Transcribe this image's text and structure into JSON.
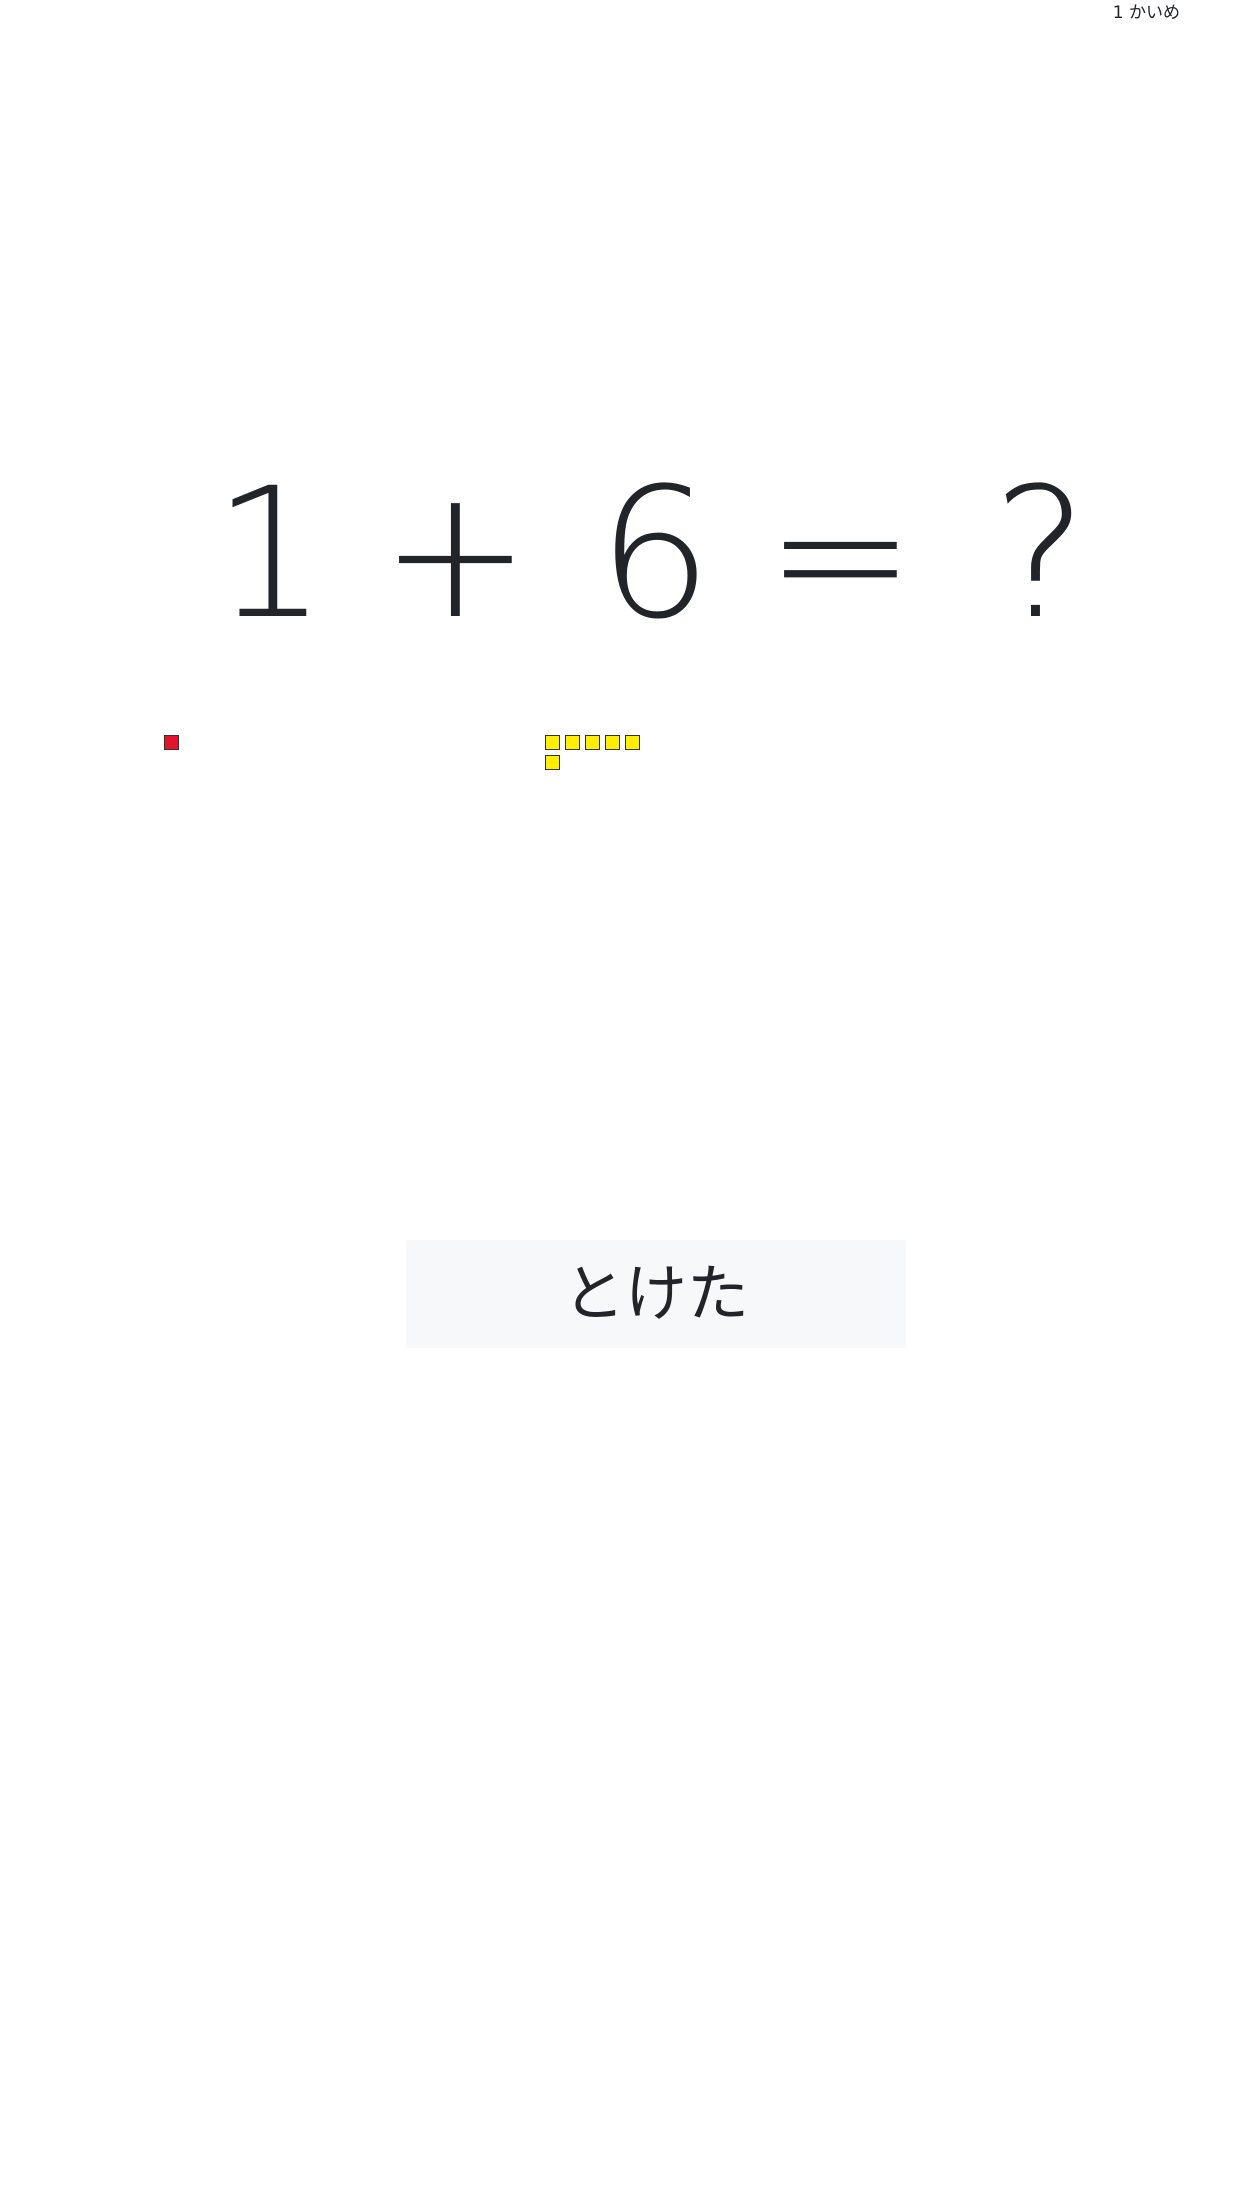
{
  "header": {
    "attempt_label": "1 かいめ"
  },
  "problem": {
    "operand_a": "1",
    "operator": "+",
    "operand_b": "6",
    "equals": "=",
    "answer_placeholder": "?"
  },
  "counters": {
    "operand_a": {
      "count": 1,
      "color": "#e0142d"
    },
    "operand_b": {
      "count": 6,
      "color": "#ffee00"
    }
  },
  "actions": {
    "solved_label": "とけた"
  },
  "colors": {
    "text": "#212529",
    "button_bg": "#f7f8fa",
    "block_border": "#333333"
  }
}
